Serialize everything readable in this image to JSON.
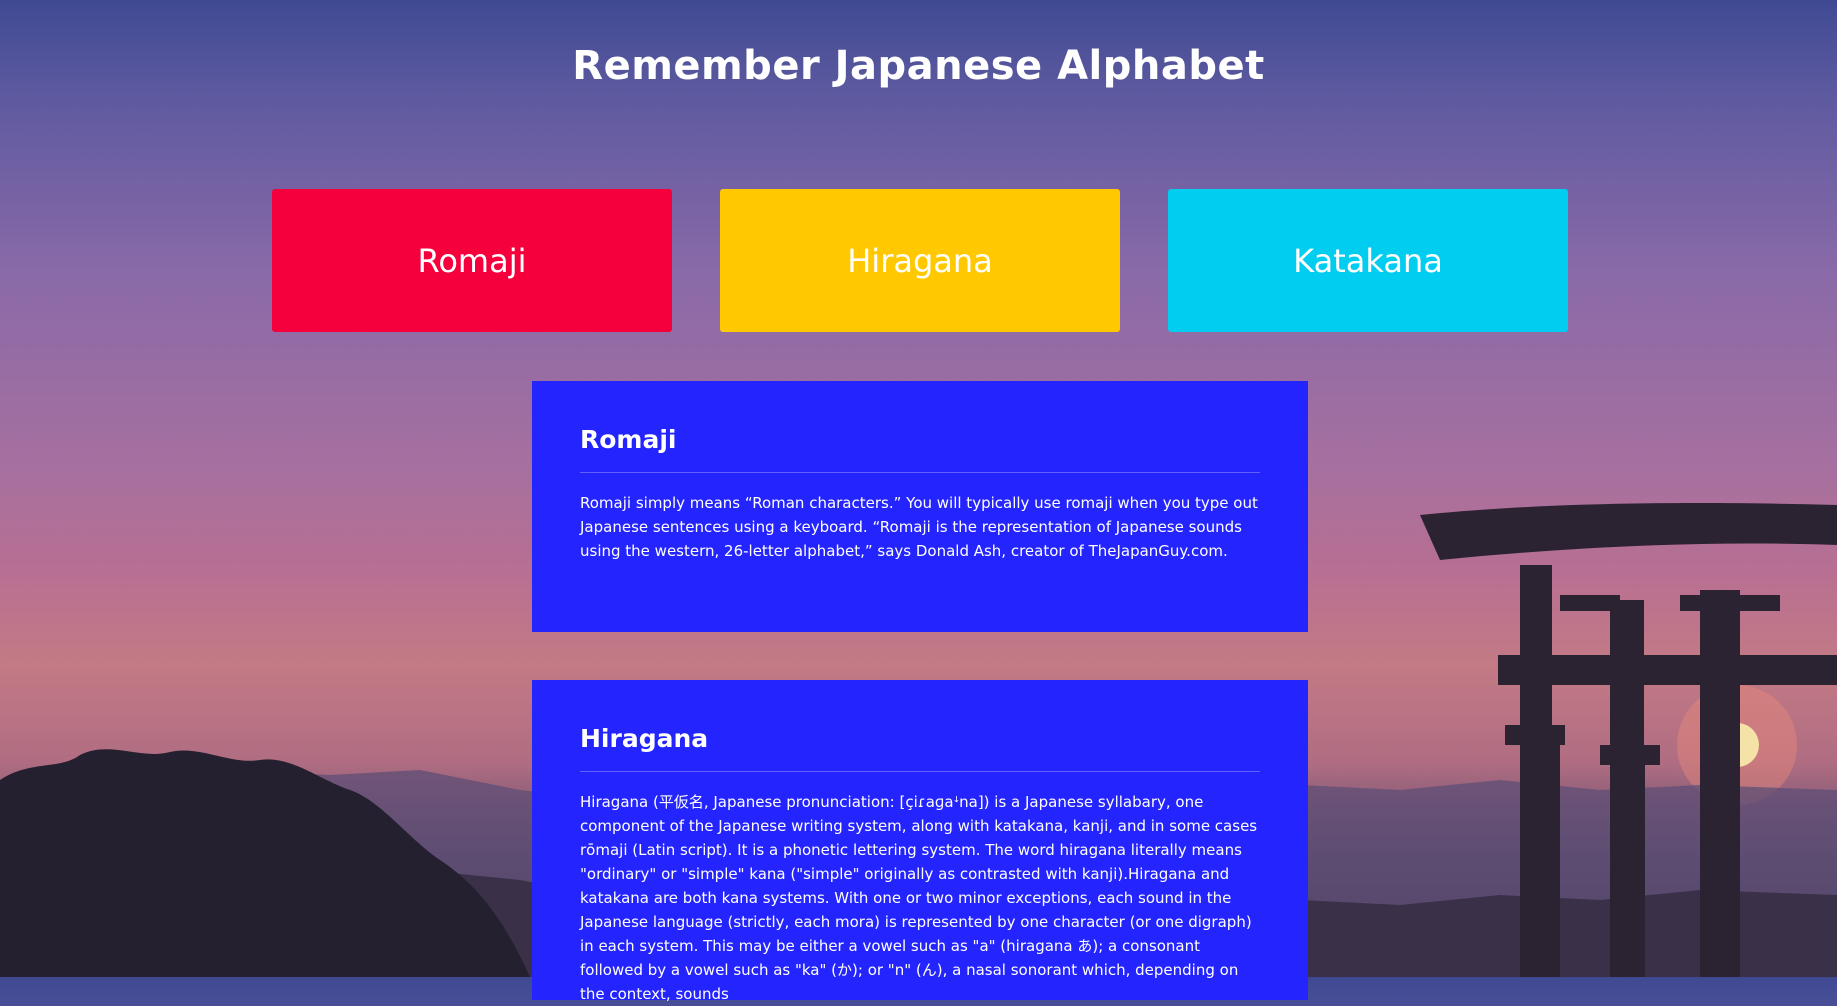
{
  "page": {
    "title": "Remember Japanese Alphabet"
  },
  "tabs": [
    {
      "label": "Romaji",
      "color": "#f5003c"
    },
    {
      "label": "Hiragana",
      "color": "#ffc800"
    },
    {
      "label": "Katakana",
      "color": "#00cdf0"
    }
  ],
  "sections": [
    {
      "heading": "Romaji",
      "body": "Romaji simply means “Roman characters.” You will typically use romaji when you type out Japanese sentences using a keyboard. “Romaji is the representation of Japanese sounds using the western, 26-letter alphabet,” says Donald Ash, creator of TheJapanGuy.com."
    },
    {
      "heading": "Hiragana",
      "body": "Hiragana (平仮名, Japanese pronunciation: [çiɾaɡaꜜna]) is a Japanese syllabary, one component of the Japanese writing system, along with katakana, kanji, and in some cases rōmaji (Latin script). It is a phonetic lettering system. The word hiragana literally means \"ordinary\" or \"simple\" kana (\"simple\" originally as contrasted with kanji).Hiragana and katakana are both kana systems. With one or two minor exceptions, each sound in the Japanese language (strictly, each mora) is represented by one character (or one digraph) in each system. This may be either a vowel such as \"a\" (hiragana あ); a consonant followed by a vowel such as \"ka\" (か); or \"n\" (ん), a nasal sonorant which, depending on the context, sounds"
    }
  ],
  "colors": {
    "card_background": "#2424ff",
    "text": "#ffffff"
  }
}
